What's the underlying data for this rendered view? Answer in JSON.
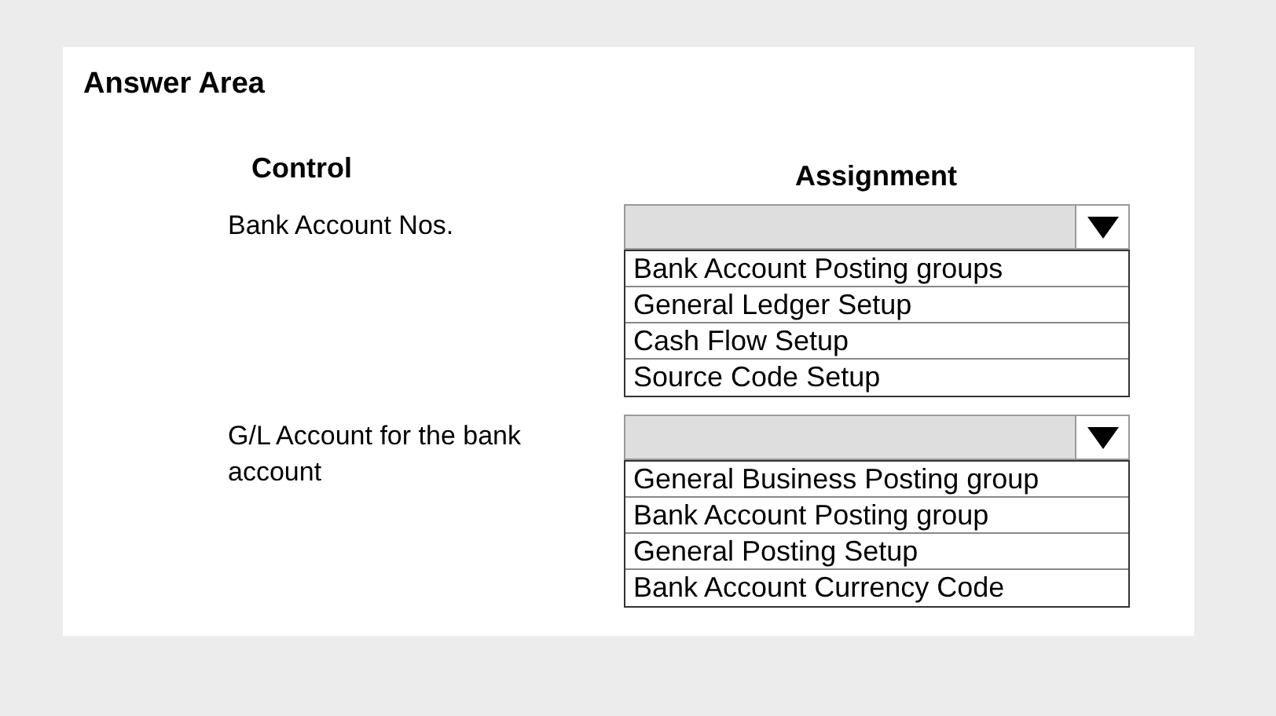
{
  "title": "Answer Area",
  "columns": [
    "Control",
    "Assignment"
  ],
  "groups": [
    {
      "label": "Bank Account Nos.",
      "options": [
        "Bank Account Posting groups",
        "General Ledger Setup",
        "Cash Flow Setup",
        "Source Code Setup"
      ]
    },
    {
      "label": "G/L Account for the bank account",
      "options": [
        "General Business Posting group",
        "Bank Account Posting group",
        "General Posting Setup",
        "Bank Account Currency Code"
      ]
    }
  ]
}
